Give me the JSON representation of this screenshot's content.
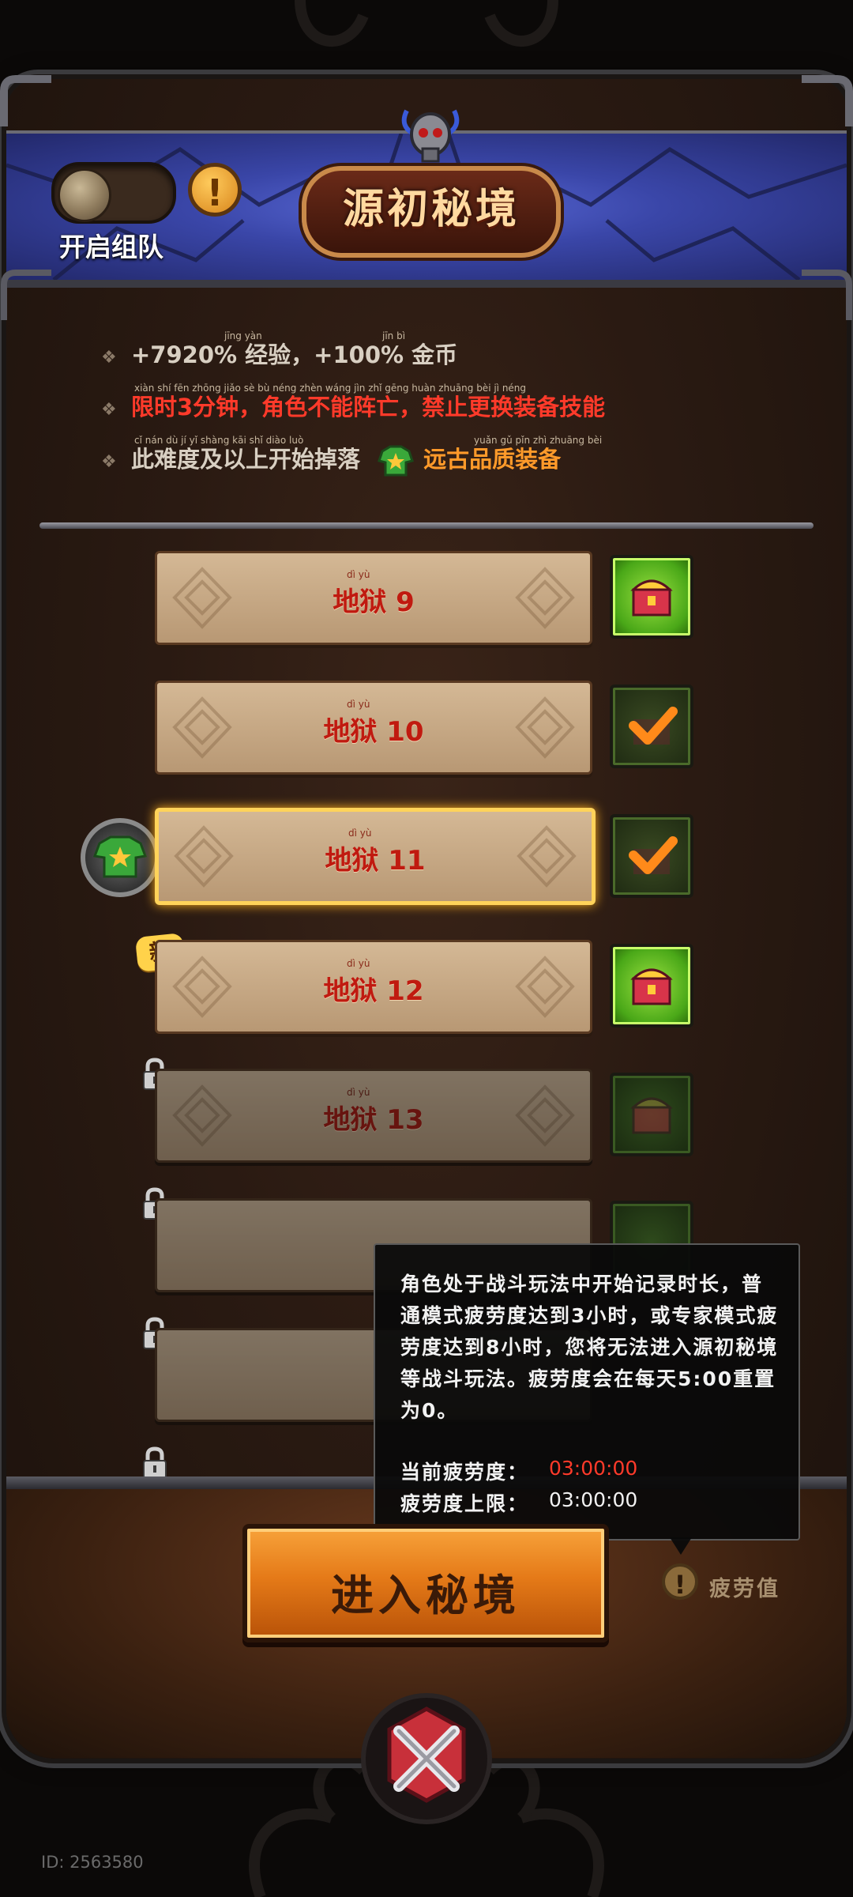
{
  "header": {
    "team_toggle_label": "开启组队",
    "title": "源初秘境",
    "info_symbol": "!"
  },
  "info": {
    "line1": "+7920% 经验，+100% 金币",
    "line2": "限时3分钟，角色不能阵亡，禁止更换装备技能",
    "line3_prefix": "此难度及以上开始掉落",
    "line3_highlight": "远古品质装备",
    "pinyin1a": "jīng yàn",
    "pinyin1b": "jīn bì",
    "pinyin2": "xiàn shí fēn zhōng   jiǎo sè bù néng zhèn wáng   jìn zhǐ gēng huàn zhuāng bèi jì néng",
    "pinyin3": "cǐ nán dù jí yǐ shàng kāi shǐ diào luò",
    "pinyin3b": "yuǎn gǔ pǐn zhì zhuāng bèi"
  },
  "levels": [
    {
      "label": "地狱 9",
      "pinyin": "dì yù"
    },
    {
      "label": "地狱 10",
      "pinyin": "dì yù"
    },
    {
      "label": "地狱 11",
      "pinyin": "dì yù"
    },
    {
      "label": "地狱 12",
      "pinyin": "dì yù"
    },
    {
      "label": "地狱 13",
      "pinyin": "dì yù"
    }
  ],
  "new_badge": "新",
  "tooltip": {
    "body": "角色处于战斗玩法中开始记录时长，普通模式疲劳度达到3小时，或专家模式疲劳度达到8小时，您将无法进入源初秘境等战斗玩法。疲劳度会在每天5:00重置为0。",
    "current_label": "当前疲劳度：",
    "current_value": "03:00:00",
    "max_label": "疲劳度上限：",
    "max_value": "03:00:00",
    "current_color": "#ff3a2a"
  },
  "enter_button": "进入秘境",
  "fatigue_label": "疲劳值",
  "fatigue_symbol": "!",
  "footer_id": "ID: 2563580",
  "colors": {
    "red_text": "#ff3a2a",
    "orange_text": "#ff9a2a",
    "accent_gold": "#ffd35a"
  }
}
